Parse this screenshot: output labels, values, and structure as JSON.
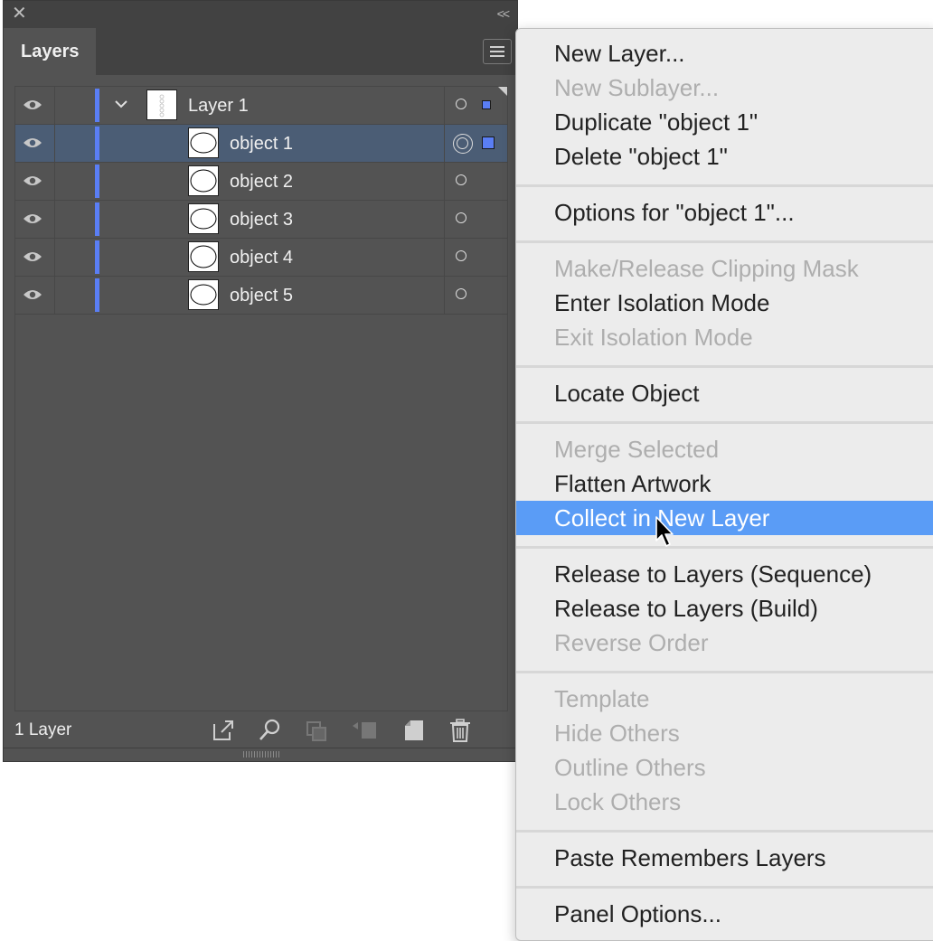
{
  "panel": {
    "close_glyph": "✕",
    "collapse_glyph": "<<",
    "tab_label": "Layers",
    "footer_label": "1 Layer",
    "layer_color": "#5a7ef4",
    "rows": [
      {
        "label": "Layer 1",
        "type": "layer",
        "expanded": true
      },
      {
        "label": "object 1",
        "type": "object",
        "selected": true
      },
      {
        "label": "object 2",
        "type": "object"
      },
      {
        "label": "object 3",
        "type": "object"
      },
      {
        "label": "object 4",
        "type": "object"
      },
      {
        "label": "object 5",
        "type": "object"
      }
    ],
    "footer_icons": [
      "export-icon",
      "locate-object-icon",
      "make-clipping-mask-icon",
      "create-sublayer-icon",
      "new-layer-icon",
      "trash-icon"
    ]
  },
  "menu": {
    "highlight_color": "#5a9cf6",
    "items": [
      {
        "label": "New Layer...",
        "enabled": true
      },
      {
        "label": "New Sublayer...",
        "enabled": false
      },
      {
        "label": "Duplicate \"object 1\"",
        "enabled": true
      },
      {
        "label": "Delete \"object 1\"",
        "enabled": true
      },
      {
        "label": "Options for \"object 1\"...",
        "enabled": true
      },
      {
        "label": "Make/Release Clipping Mask",
        "enabled": false
      },
      {
        "label": "Enter Isolation Mode",
        "enabled": true
      },
      {
        "label": "Exit Isolation Mode",
        "enabled": false
      },
      {
        "label": "Locate Object",
        "enabled": true
      },
      {
        "label": "Merge Selected",
        "enabled": false
      },
      {
        "label": "Flatten Artwork",
        "enabled": true
      },
      {
        "label": "Collect in New Layer",
        "enabled": true,
        "highlighted": true
      },
      {
        "label": "Release to Layers (Sequence)",
        "enabled": true
      },
      {
        "label": "Release to Layers (Build)",
        "enabled": true
      },
      {
        "label": "Reverse Order",
        "enabled": false
      },
      {
        "label": "Template",
        "enabled": false
      },
      {
        "label": "Hide Others",
        "enabled": false
      },
      {
        "label": "Outline Others",
        "enabled": false
      },
      {
        "label": "Lock Others",
        "enabled": false
      },
      {
        "label": "Paste Remembers Layers",
        "enabled": true
      },
      {
        "label": "Panel Options...",
        "enabled": true
      }
    ]
  }
}
